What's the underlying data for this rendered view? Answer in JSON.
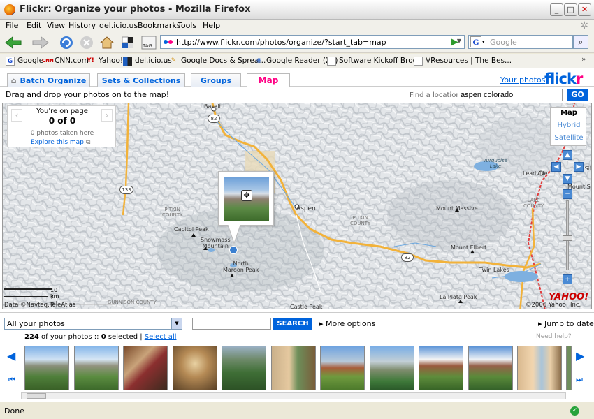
{
  "window": {
    "title": "Flickr: Organize your photos - Mozilla Firefox",
    "min": "_",
    "max": "□",
    "close": "✕"
  },
  "menu": [
    "File",
    "Edit",
    "View",
    "History",
    "del.icio.us",
    "Bookmarks",
    "Tools",
    "Help"
  ],
  "nav": {
    "url": "http://www.flickr.com/photos/organize/?start_tab=map",
    "search_placeholder": "Google",
    "tag_label": "TAG"
  },
  "bookmarks": [
    {
      "icon": "google-icon",
      "label": "Google"
    },
    {
      "icon": "cnn-icon",
      "label": "CNN.com"
    },
    {
      "icon": "yahoo-icon",
      "label": "Yahoo!"
    },
    {
      "icon": "delicious-icon",
      "label": "del.icio.us"
    },
    {
      "icon": "docs-icon",
      "label": "Google Docs & Sprea..."
    },
    {
      "icon": "reader-icon",
      "label": "Google Reader (25)"
    },
    {
      "icon": "page-icon",
      "label": "Software Kickoff Broo..."
    },
    {
      "icon": "page-icon",
      "label": "VResources | The Bes..."
    }
  ],
  "tabs": {
    "batch": "Batch Organize",
    "sets": "Sets & Collections",
    "groups": "Groups",
    "map": "Map",
    "your_photos": "Your photos",
    "logo_a": "flick",
    "logo_b": "r"
  },
  "map_header": {
    "hint": "Drag and drop your photos on to the map!",
    "find_label": "Find a location",
    "find_value": "aspen colorado",
    "go": "GO"
  },
  "pager": {
    "line1": "You're on page",
    "line2": "0 of 0",
    "line3": "0 photos taken here",
    "explore": "Explore this map",
    "prev": "‹",
    "next": "›"
  },
  "map_types": {
    "map": "Map",
    "hybrid": "Hybrid",
    "satellite": "Satellite"
  },
  "map_labels": {
    "basalt": "Basalt",
    "aspen": "Aspen",
    "capitol": "Capitol Peak",
    "snowmass": "Snowmass\nMountain",
    "maroon": "North\nMaroon Peak",
    "massive": "Mount Massive",
    "elbert": "Mount Elbert",
    "twin": "Twin Lakes",
    "laplata": "La Plata Peak",
    "castle": "Castle Peak",
    "leadville": "Leadville",
    "turquoise": "Turquoise\nLake",
    "mtshe": "Mount She",
    "mtsilv": "Mt Silv",
    "pitkin1": "PITKIN\nCOUNTY",
    "pitkin2": "PITKIN\nCOUNTY",
    "lake": "LAKE\nCOUNTY",
    "gunnison": "GUNNISON COUNTY",
    "hw82a": "82",
    "hw82b": "82",
    "hw133": "133"
  },
  "map_footer": {
    "km": "10 km",
    "mi": "7 mi",
    "data": "Data ©Navteq,TeleAtlas",
    "copy": "©2006 Yahoo! Inc.",
    "yahoo": "YAHOO!"
  },
  "filter": {
    "select": "All your photos",
    "search": "SEARCH",
    "more": "More options",
    "jump": "Jump to date",
    "count_num": "224",
    "count_mid": " of your photos :: ",
    "count_sel": "0",
    "count_end": " selected | ",
    "select_all": "Select all",
    "help": "Need help?"
  },
  "status": {
    "text": "Done"
  },
  "colors": {
    "flickr_blue": "#0063dc",
    "flickr_pink": "#ff0084"
  }
}
